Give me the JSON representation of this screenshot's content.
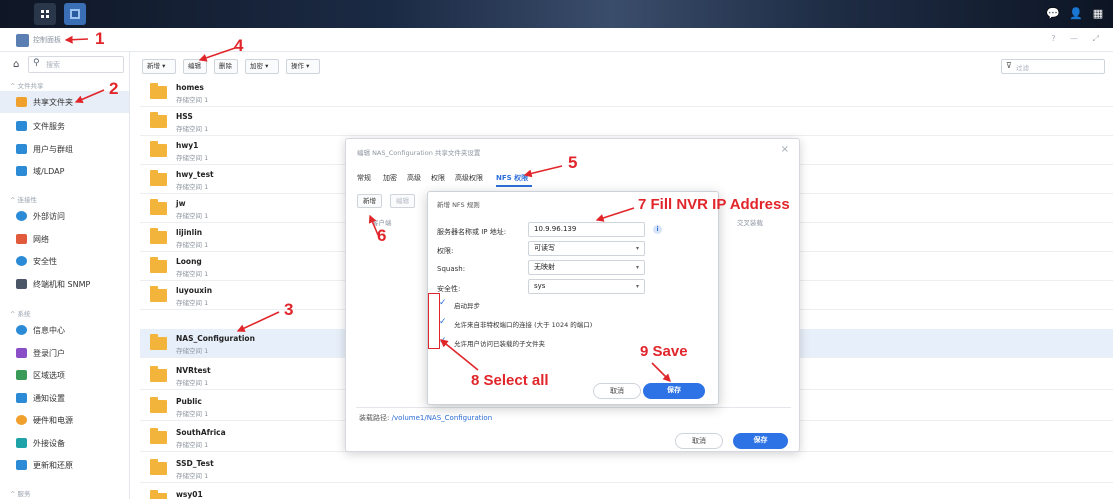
{
  "app_title": "控制面板",
  "sidebar": {
    "search_placeholder": "搜索",
    "groups": [
      "文件共享",
      "连接性",
      "系统",
      "服务"
    ],
    "items": [
      {
        "label": "共享文件夹",
        "icon": "shared-folder-icon",
        "color": "#f0a02c",
        "active": true
      },
      {
        "label": "文件服务",
        "icon": "file-services-icon",
        "color": "#2b8bd6"
      },
      {
        "label": "用户与群组",
        "icon": "user-group-icon",
        "color": "#2b8bd6"
      },
      {
        "label": "域/LDAP",
        "icon": "domain-ldap-icon",
        "color": "#2b8bd6"
      },
      {
        "label": "外部访问",
        "icon": "external-access-icon",
        "color": "#2b8bd6"
      },
      {
        "label": "网络",
        "icon": "network-icon",
        "color": "#e05a3b"
      },
      {
        "label": "安全性",
        "icon": "security-icon",
        "color": "#2b8bd6"
      },
      {
        "label": "终端机和 SNMP",
        "icon": "terminal-icon",
        "color": "#4a5566"
      },
      {
        "label": "信息中心",
        "icon": "info-center-icon",
        "color": "#2b8bd6"
      },
      {
        "label": "登录门户",
        "icon": "login-portal-icon",
        "color": "#8a4fc7"
      },
      {
        "label": "区域选项",
        "icon": "regional-options-icon",
        "color": "#3a9b58"
      },
      {
        "label": "通知设置",
        "icon": "notification-icon",
        "color": "#2b8bd6"
      },
      {
        "label": "硬件和电源",
        "icon": "hardware-power-icon",
        "color": "#f0a02c"
      },
      {
        "label": "外接设备",
        "icon": "external-devices-icon",
        "color": "#1ea3a8"
      },
      {
        "label": "更新和还原",
        "icon": "update-restore-icon",
        "color": "#2b8bd6"
      }
    ]
  },
  "toolbar": {
    "create": "新增",
    "edit": "编辑",
    "delete": "删除",
    "encryption": "加密",
    "action": "操作",
    "filter_placeholder": "过滤"
  },
  "folders": [
    {
      "name": "homes",
      "sub": "存储空间 1"
    },
    {
      "name": "HSS",
      "sub": "存储空间 1"
    },
    {
      "name": "hwy1",
      "sub": "存储空间 1"
    },
    {
      "name": "hwy_test",
      "sub": "存储空间 1"
    },
    {
      "name": "jw",
      "sub": "存储空间 1"
    },
    {
      "name": "lijinlin",
      "sub": "存储空间 1"
    },
    {
      "name": "Loong",
      "sub": "存储空间 1"
    },
    {
      "name": "luyouxin",
      "sub": "存储空间 1"
    },
    {
      "name": "NAS_Configuration",
      "sub": "存储空间 1",
      "selected": true
    },
    {
      "name": "NVRtest",
      "sub": "存储空间 1"
    },
    {
      "name": "Public",
      "sub": "存储空间 1"
    },
    {
      "name": "SouthAfrica",
      "sub": "存储空间 1"
    },
    {
      "name": "SSD_Test",
      "sub": "存储空间 1"
    },
    {
      "name": "wsy01",
      "sub": ""
    }
  ],
  "edit_dialog": {
    "title": "编辑 NAS_Configuration 共享文件夹设置",
    "tabs": [
      "常规",
      "加密",
      "高级",
      "权限",
      "高级权限",
      "NFS 权限"
    ],
    "active_tab": "NFS 权限",
    "btn_create": "新增",
    "btn_edit": "编辑",
    "col_client": "客户端",
    "col_cross": "交叉装载",
    "path_label": "装载路径:",
    "path_value": "/volume1/NAS_Configuration",
    "cancel": "取消",
    "save": "保存"
  },
  "nfs_dialog": {
    "title": "新增 NFS 规则",
    "host_label": "服务器名称或 IP 地址:",
    "host_value": "10.9.96.139",
    "privilege_label": "权限:",
    "privilege_value": "可读写",
    "squash_label": "Squash:",
    "squash_value": "无映射",
    "security_label": "安全性:",
    "security_value": "sys",
    "checks": [
      {
        "label": "启动异步",
        "checked": true
      },
      {
        "label": "允许来自非特权端口的连接 (大于 1024 的端口)",
        "checked": true
      },
      {
        "label": "允许用户访问已装载的子文件夹",
        "checked": true
      }
    ],
    "cancel": "取消",
    "save": "保存"
  },
  "annotations": {
    "n1": "1",
    "n2": "2",
    "n3": "3",
    "n4": "4",
    "n5": "5",
    "n6": "6",
    "n7": "7 Fill NVR IP Address",
    "n8": "8 Select all",
    "n9": "9 Save"
  },
  "colors": {
    "accent": "#2e73e6",
    "annotation": "#e1262b",
    "folder": "#f2b43a"
  }
}
